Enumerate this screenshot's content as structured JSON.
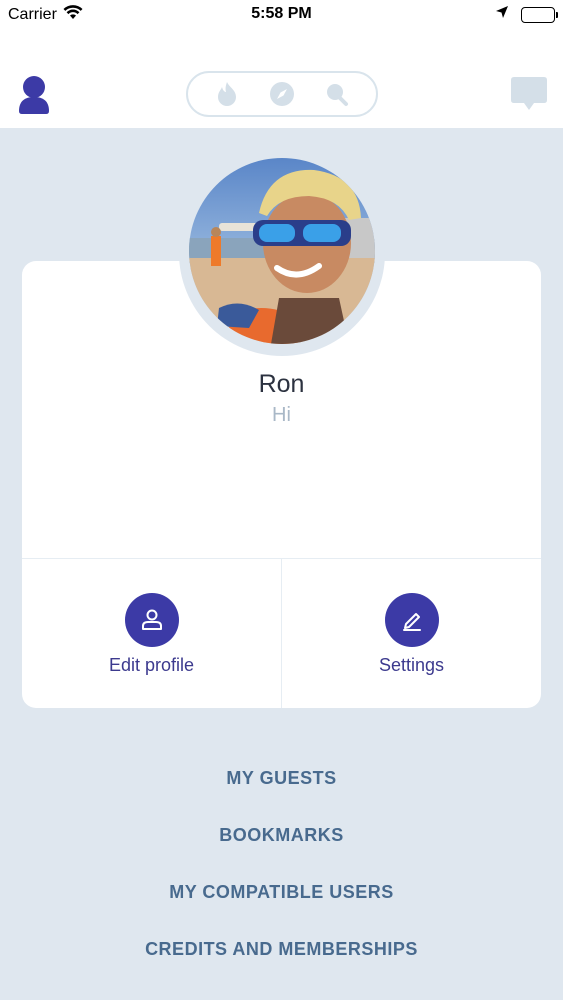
{
  "status_bar": {
    "carrier": "Carrier",
    "time": "5:58 PM"
  },
  "nav": {
    "icons": [
      "user-icon",
      "flame-icon",
      "compass-icon",
      "search-icon",
      "chat-icon"
    ],
    "accent_color": "#3c3aa6",
    "inactive_icon_color": "#d4dfe8"
  },
  "profile": {
    "name": "Ron",
    "status": "Hi"
  },
  "actions": {
    "edit_profile": "Edit profile",
    "settings": "Settings"
  },
  "menu": {
    "items": [
      "MY GUESTS",
      "BOOKMARKS",
      "MY COMPATIBLE USERS",
      "CREDITS AND MEMBERSHIPS"
    ]
  },
  "colors": {
    "background": "#dfe7ef",
    "link": "#486a8e"
  }
}
